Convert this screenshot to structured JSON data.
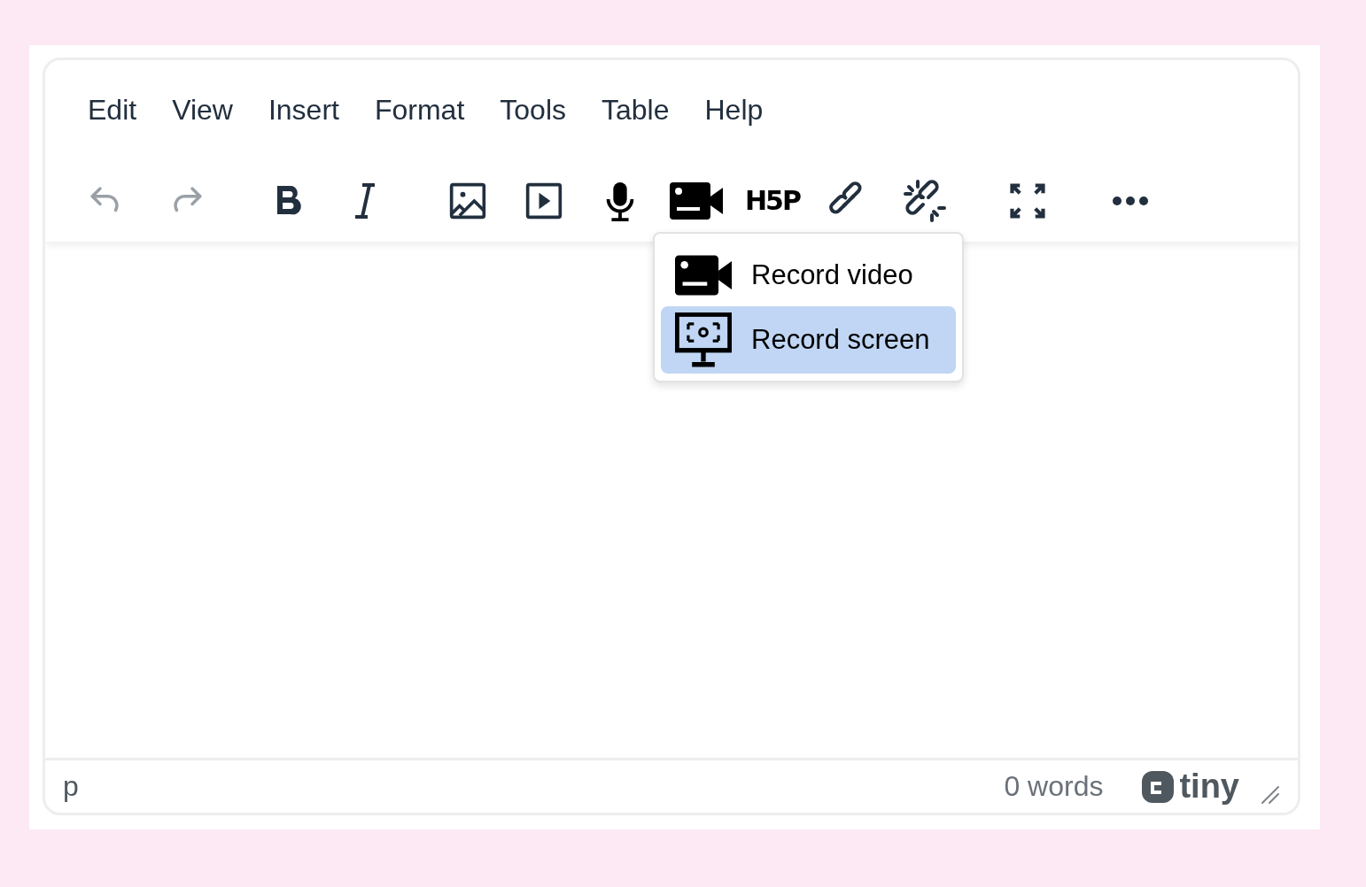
{
  "menubar": [
    {
      "label": "Edit"
    },
    {
      "label": "View"
    },
    {
      "label": "Insert"
    },
    {
      "label": "Format"
    },
    {
      "label": "Tools"
    },
    {
      "label": "Table"
    },
    {
      "label": "Help"
    }
  ],
  "toolbar": [
    {
      "buttons": [
        {
          "kind": "undo",
          "disabled": true
        },
        {
          "kind": "redo",
          "disabled": true
        }
      ]
    },
    {
      "buttons": [
        {
          "kind": "bold",
          "disabled": false
        },
        {
          "kind": "italic",
          "disabled": false
        }
      ]
    },
    {
      "buttons": [
        {
          "kind": "image",
          "disabled": false
        },
        {
          "kind": "media",
          "disabled": false
        },
        {
          "kind": "mic",
          "disabled": false
        },
        {
          "kind": "video",
          "disabled": false
        },
        {
          "kind": "h5p",
          "label": "H5P",
          "disabled": false
        },
        {
          "kind": "link",
          "disabled": false
        },
        {
          "kind": "unlink",
          "disabled": false
        }
      ]
    },
    {
      "buttons": [
        {
          "kind": "fullscreen",
          "disabled": false
        }
      ]
    },
    {
      "buttons": [
        {
          "kind": "more",
          "disabled": false
        }
      ]
    }
  ],
  "dropdown": [
    {
      "kind": "video",
      "label": "Record video",
      "selected": false
    },
    {
      "kind": "screen",
      "label": "Record screen",
      "selected": true
    }
  ],
  "status_bar": {
    "path": "p",
    "word_count": "0 words",
    "logo": "tiny"
  }
}
